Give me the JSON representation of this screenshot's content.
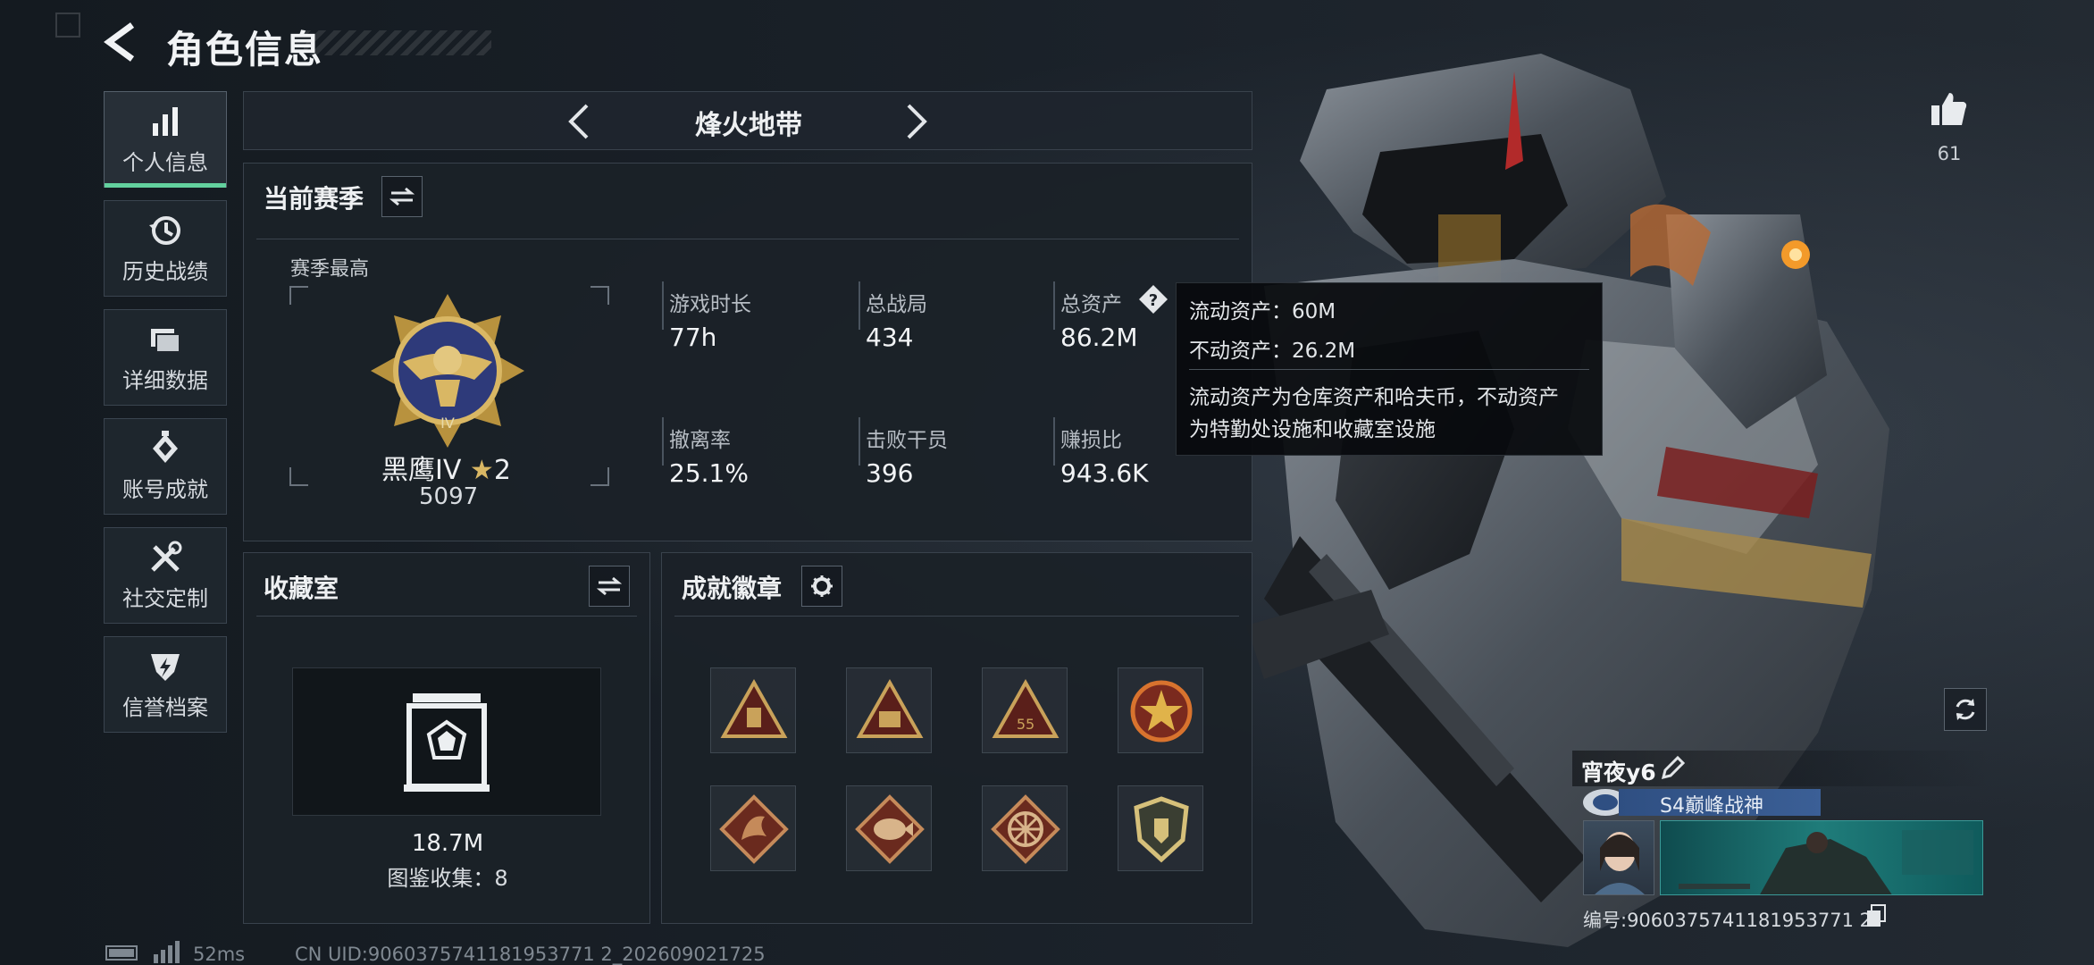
{
  "header": {
    "title": "角色信息"
  },
  "sidebar": {
    "items": [
      {
        "label": "个人信息",
        "icon": "bar-chart-icon",
        "active": true
      },
      {
        "label": "历史战绩",
        "icon": "history-clock-icon",
        "active": false
      },
      {
        "label": "详细数据",
        "icon": "folder-icon",
        "active": false
      },
      {
        "label": "账号成就",
        "icon": "medal-icon",
        "active": false
      },
      {
        "label": "社交定制",
        "icon": "tools-icon",
        "active": false
      },
      {
        "label": "信誉档案",
        "icon": "shield-icon",
        "active": false
      }
    ]
  },
  "mode": {
    "title": "烽火地带"
  },
  "season": {
    "title": "当前赛季",
    "best_label": "赛季最高",
    "rank_name": "黑鹰IV",
    "rank_stars": "2",
    "rank_score": "5097",
    "stats": [
      {
        "label": "游戏时长",
        "value": "77h"
      },
      {
        "label": "总战局",
        "value": "434"
      },
      {
        "label": "总资产",
        "value": "86.2M"
      },
      {
        "label": "撤离率",
        "value": "25.1%"
      },
      {
        "label": "击败干员",
        "value": "396"
      },
      {
        "label": "赚损比",
        "value": "943.6K"
      }
    ]
  },
  "tooltip": {
    "liquid": "流动资产：60M",
    "fixed": "不动资产：26.2M",
    "desc_line1": "流动资产为仓库资产和哈夫币，不动资产",
    "desc_line2": "为特勤处设施和收藏室设施"
  },
  "collection": {
    "title": "收藏室",
    "value": "18.7M",
    "count_text": "图鉴收集：8"
  },
  "achievements": {
    "title": "成就徽章",
    "badges": [
      {
        "icon": "triangle-badge-icon",
        "color": "#c9a25a"
      },
      {
        "icon": "triangle-badge-icon",
        "color": "#c9a25a"
      },
      {
        "icon": "triangle-55-badge-icon",
        "color": "#c9a25a",
        "label": "55"
      },
      {
        "icon": "star-emblem-badge-icon",
        "color": "#d8732e"
      },
      {
        "icon": "dragon-badge-icon",
        "color": "#c58a5a"
      },
      {
        "icon": "fish-badge-icon",
        "color": "#c58a5a"
      },
      {
        "icon": "wheel-badge-icon",
        "color": "#c58a5a"
      },
      {
        "icon": "shield-badge-icon",
        "color": "#d6c07a"
      }
    ]
  },
  "status": {
    "ping": "52ms",
    "uid": "CN UID:9060375741181953771 2_202609021725"
  },
  "profile": {
    "like_count": "61",
    "player_name": "宵夜y6",
    "player_title": "S4巅峰战神",
    "id_text": "编号:9060375741181953771 2"
  },
  "colors": {
    "accent_green": "#63d19e",
    "gold": "#c9a25a",
    "title_plate_blue": "#35578c"
  }
}
